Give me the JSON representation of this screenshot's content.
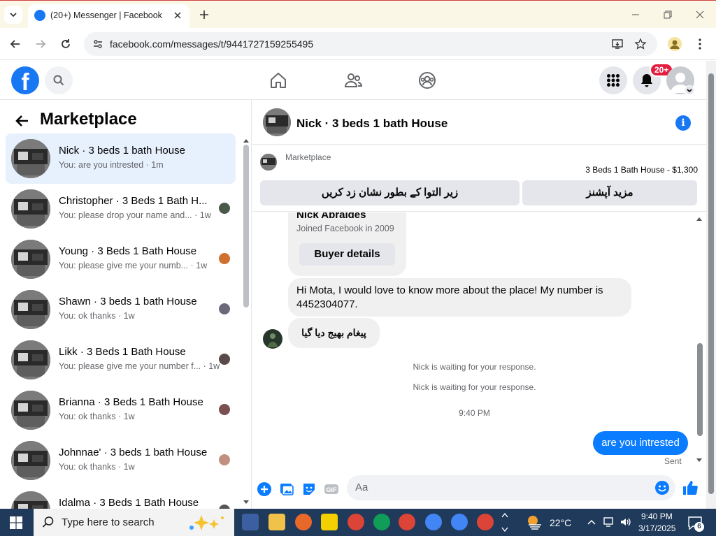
{
  "browser": {
    "tab_title": "(20+) Messenger | Facebook",
    "url": "facebook.com/messages/t/9441727159255495"
  },
  "fb_header": {
    "notification_badge": "20+",
    "logo_letter": "f"
  },
  "left": {
    "title": "Marketplace",
    "conversations": [
      {
        "name": "Nick · 3 beds 1 bath House",
        "preview": "You: are you intrested · 1m",
        "active": true
      },
      {
        "name": "Christopher · 3 Beds 1 Bath H...",
        "preview": "You: please drop your name and... · 1w"
      },
      {
        "name": "Young · 3 Beds 1 Bath House",
        "preview": "You: please give me your numb... · 1w"
      },
      {
        "name": "Shawn · 3 beds 1 bath House",
        "preview": "You: ok thanks · 1w"
      },
      {
        "name": "Likk · 3 Beds 1 Bath House",
        "preview": "You: please give me your number f... · 1w"
      },
      {
        "name": "Brianna · 3 Beds 1 Bath House",
        "preview": "You: ok thanks · 1w"
      },
      {
        "name": "Johnnae' · 3 beds 1 bath House",
        "preview": "You: ok thanks · 1w"
      },
      {
        "name": "Idalma · 3 Beds 1 Bath House",
        "preview": ""
      }
    ]
  },
  "chat": {
    "title": "Nick · 3 beds 1 bath House",
    "marketplace_label": "Marketplace",
    "listing": "3 Beds 1 Bath House - $1,300",
    "btn_more": "مزید آپشنز",
    "btn_mark": "زیر التوا کے بطور نشان زد کریں",
    "buyer_name": "Nick Abraldes",
    "buyer_joined": "Joined Facebook in 2009",
    "buyer_details": "Buyer details",
    "msg_in": "Hi Mota, I would love to know more about the place! My number is 4452304077.",
    "msg_sent_urdu": "پیغام بھیج دیا گیا",
    "waiting_1": "Nick is waiting for your response.",
    "waiting_2": "Nick is waiting for your response.",
    "time": "9:40 PM",
    "my_msg": "are you intrested",
    "sent": "Sent",
    "composer_placeholder": "Aa"
  },
  "taskbar": {
    "search": "Type here to search",
    "weather": "22°C",
    "time": "9:40 PM",
    "date": "3/17/2025",
    "notif_count": "6"
  }
}
